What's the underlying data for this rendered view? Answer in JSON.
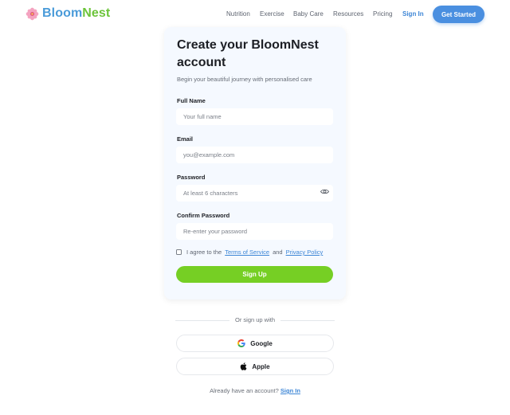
{
  "brand": {
    "part1": "Bloom",
    "part2": "Nest",
    "icon": "flower-icon"
  },
  "nav": {
    "links": [
      "Nutrition",
      "Exercise",
      "Baby Care",
      "Resources",
      "Pricing"
    ],
    "sign_in": "Sign In",
    "cta": "Get Started"
  },
  "form": {
    "title": "Create your BloomNest account",
    "subtitle": "Begin your beautiful journey with personalised care",
    "full_name": {
      "label": "Full Name",
      "placeholder": "Your full name",
      "value": ""
    },
    "email": {
      "label": "Email",
      "placeholder": "you@example.com",
      "value": ""
    },
    "password": {
      "label": "Password",
      "placeholder": "At least 6 characters",
      "value": "",
      "toggle_icon": "eye-icon"
    },
    "confirm": {
      "label": "Confirm Password",
      "placeholder": "Re-enter your password",
      "value": ""
    },
    "agree": {
      "prefix": "I agree to the",
      "terms": "Terms of Service",
      "and": "and",
      "privacy": "Privacy Policy",
      "checked": false
    },
    "submit": "Sign Up"
  },
  "social": {
    "divider": "Or sign up with",
    "google": {
      "label": "Google",
      "icon": "google-icon"
    },
    "apple": {
      "label": "Apple",
      "icon": "apple-icon"
    }
  },
  "footer": {
    "prompt": "Already have an account?",
    "link": "Sign In"
  },
  "colors": {
    "brand_blue": "#4a9bd9",
    "brand_green": "#6cc43a",
    "cta_blue": "#4a8fe0",
    "submit_green": "#76cf24",
    "link_blue": "#3d86d6",
    "card_bg": "#f5f9ff"
  }
}
